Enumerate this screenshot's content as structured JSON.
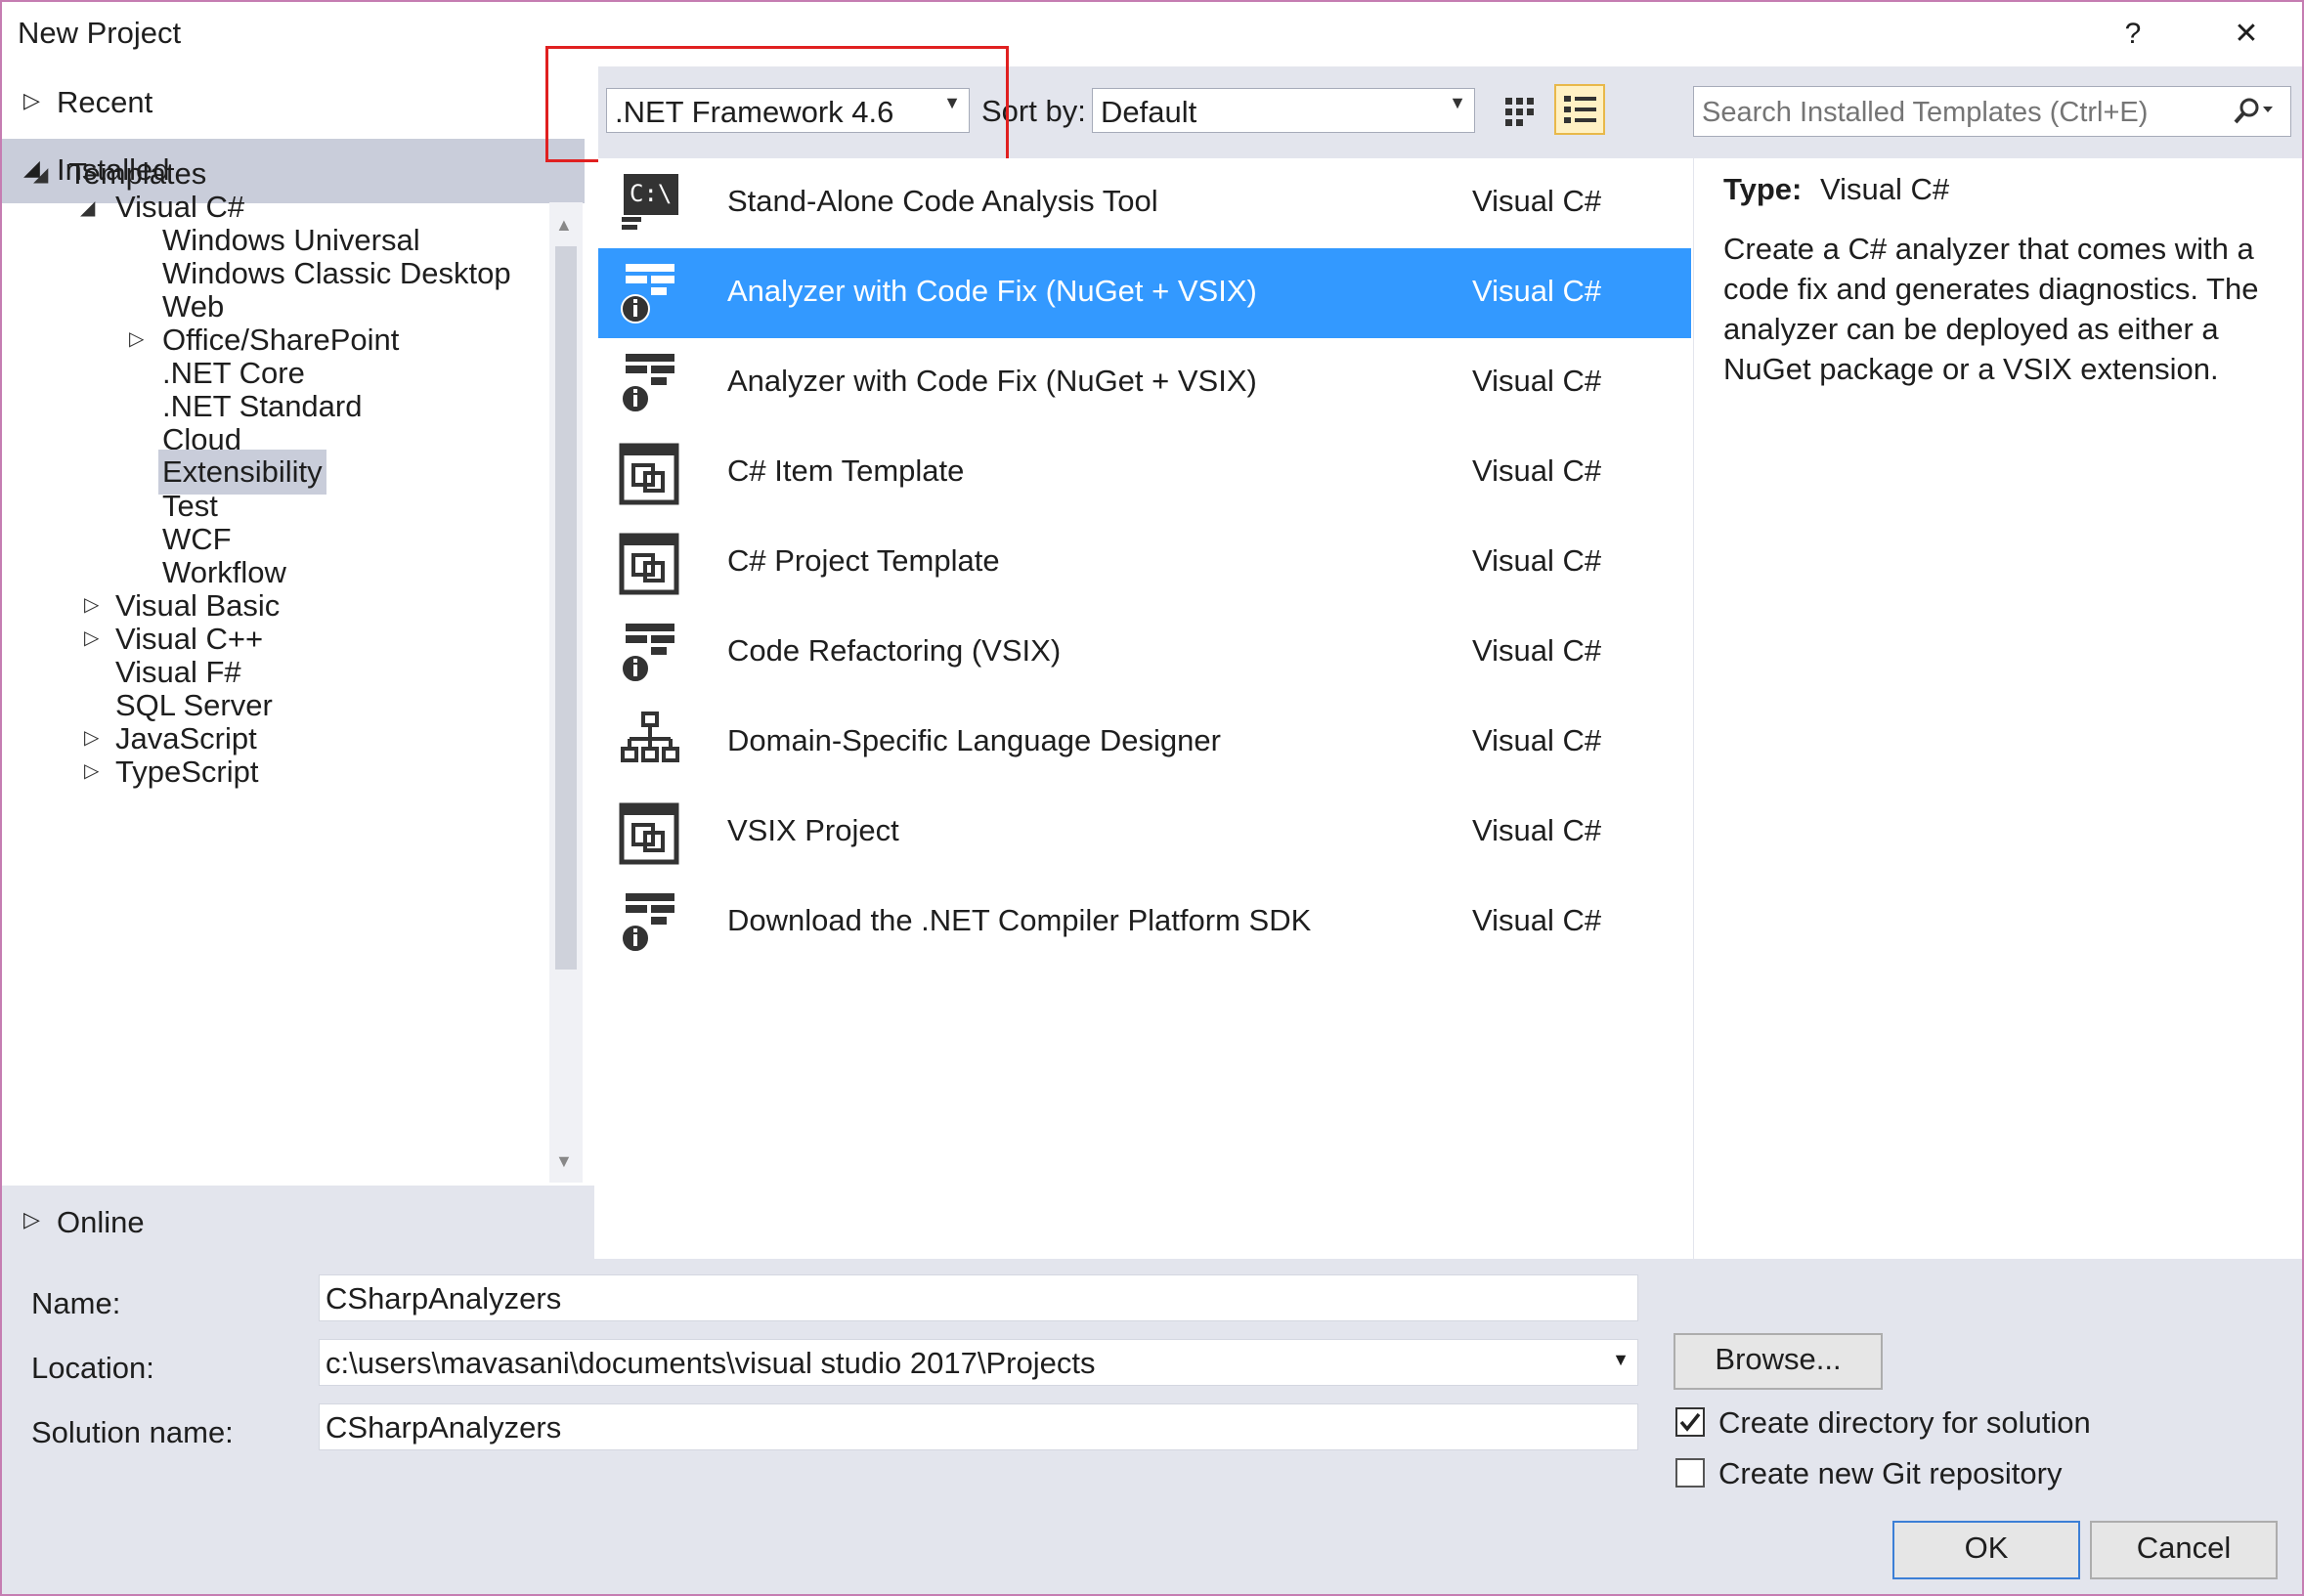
{
  "window": {
    "title": "New Project",
    "help_label": "?",
    "close_label": "✕"
  },
  "nav": {
    "recent": "Recent",
    "installed": "Installed",
    "online": "Online",
    "tree": [
      {
        "label": "Templates"
      },
      {
        "label": "Visual C#"
      },
      {
        "label": "Windows Universal"
      },
      {
        "label": "Windows Classic Desktop"
      },
      {
        "label": "Web"
      },
      {
        "label": "Office/SharePoint"
      },
      {
        "label": ".NET Core"
      },
      {
        "label": ".NET Standard"
      },
      {
        "label": "Cloud"
      },
      {
        "label": "Extensibility"
      },
      {
        "label": "Test"
      },
      {
        "label": "WCF"
      },
      {
        "label": "Workflow"
      },
      {
        "label": "Visual Basic"
      },
      {
        "label": "Visual C++"
      },
      {
        "label": "Visual F#"
      },
      {
        "label": "SQL Server"
      },
      {
        "label": "JavaScript"
      },
      {
        "label": "TypeScript"
      }
    ]
  },
  "toolbar": {
    "framework": ".NET Framework 4.6",
    "sort_label": "Sort by:",
    "sort_value": "Default",
    "search_placeholder": "Search Installed Templates (Ctrl+E)"
  },
  "templates": [
    {
      "name": "Stand-Alone Code Analysis Tool",
      "lang": "Visual C#",
      "icon": "console-app-icon"
    },
    {
      "name": "Analyzer with Code Fix (NuGet + VSIX)",
      "lang": "Visual C#",
      "icon": "analyzer-icon",
      "selected": true
    },
    {
      "name": "Analyzer with Code Fix (NuGet + VSIX)",
      "lang": "Visual C#",
      "icon": "analyzer-icon"
    },
    {
      "name": "C# Item Template",
      "lang": "Visual C#",
      "icon": "template-icon"
    },
    {
      "name": "C# Project Template",
      "lang": "Visual C#",
      "icon": "template-icon"
    },
    {
      "name": "Code Refactoring (VSIX)",
      "lang": "Visual C#",
      "icon": "analyzer-icon"
    },
    {
      "name": "Domain-Specific Language Designer",
      "lang": "Visual C#",
      "icon": "hierarchy-icon"
    },
    {
      "name": "VSIX Project",
      "lang": "Visual C#",
      "icon": "template-icon"
    },
    {
      "name": "Download the .NET Compiler Platform SDK",
      "lang": "Visual C#",
      "icon": "analyzer-icon"
    }
  ],
  "details": {
    "type_label": "Type:",
    "type_value": "Visual C#",
    "description": "Create a C# analyzer that comes with a code fix and generates diagnostics. The analyzer can be deployed as either a NuGet package or a VSIX extension."
  },
  "form": {
    "name_label": "Name:",
    "name_value": "CSharpAnalyzers",
    "location_label": "Location:",
    "location_value": "c:\\users\\mavasani\\documents\\visual studio 2017\\Projects",
    "solution_label": "Solution name:",
    "solution_value": "CSharpAnalyzers",
    "browse_label": "Browse...",
    "create_dir_label": "Create directory for solution",
    "create_dir_checked": true,
    "git_label": "Create new Git repository",
    "git_checked": false,
    "ok_label": "OK",
    "cancel_label": "Cancel"
  },
  "colors": {
    "selection": "#3399ff",
    "highlight_box": "#e02020",
    "panel": "#e3e5ed"
  }
}
